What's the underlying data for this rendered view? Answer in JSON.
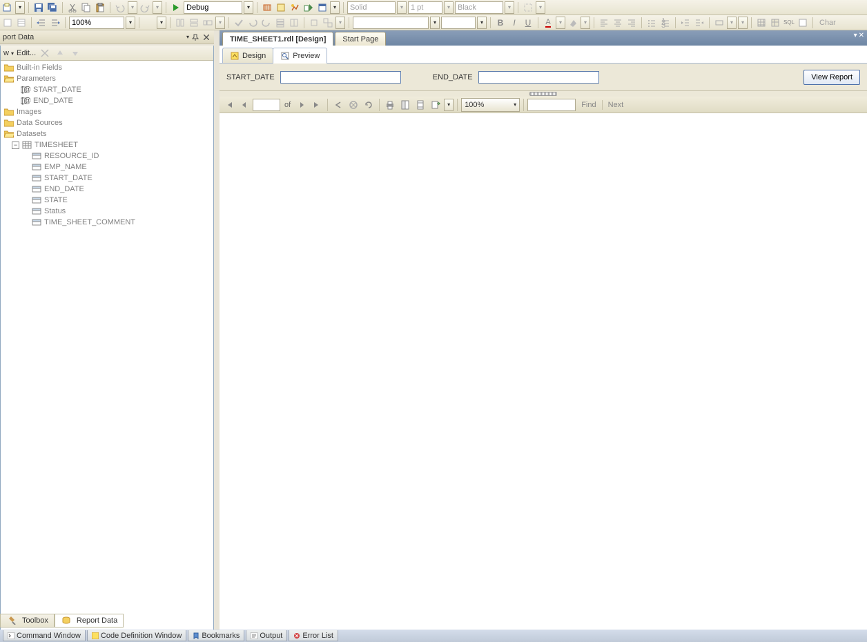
{
  "toolbar1": {
    "config": "Debug",
    "font_name": "Solid",
    "font_size": "1 pt",
    "color_name": "Black",
    "chart_label": "Char"
  },
  "toolbar2": {
    "zoom": "100%"
  },
  "left_panel": {
    "title": "port Data",
    "toolbar": {
      "new": "w",
      "edit": "Edit..."
    },
    "tree": {
      "built_in": "Built-in Fields",
      "parameters": "Parameters",
      "param_items": [
        "START_DATE",
        "END_DATE"
      ],
      "images": "Images",
      "datasources": "Data Sources",
      "datasets": "Datasets",
      "dataset_name": "TIMESHEET",
      "fields": [
        "RESOURCE_ID",
        "EMP_NAME",
        "START_DATE",
        "END_DATE",
        "STATE",
        "Status",
        "TIME_SHEET_COMMENT"
      ]
    },
    "bottom_tabs": {
      "toolbox": "Toolbox",
      "report_data": "Report Data"
    }
  },
  "content": {
    "file_tabs": {
      "active": "TIME_SHEET1.rdl [Design]",
      "inactive": "Start Page"
    },
    "inner_tabs": {
      "design": "Design",
      "preview": "Preview"
    },
    "params": {
      "start_label": "START_DATE",
      "start_value": "",
      "end_label": "END_DATE",
      "end_value": "",
      "view_report": "View Report"
    },
    "report_nav": {
      "page_value": "",
      "of": "of",
      "zoom": "100%",
      "find_value": "",
      "find": "Find",
      "next": "Next"
    }
  },
  "footer_tabs": [
    "Command Window",
    "Code Definition Window",
    "Bookmarks",
    "Output",
    "Error List"
  ]
}
